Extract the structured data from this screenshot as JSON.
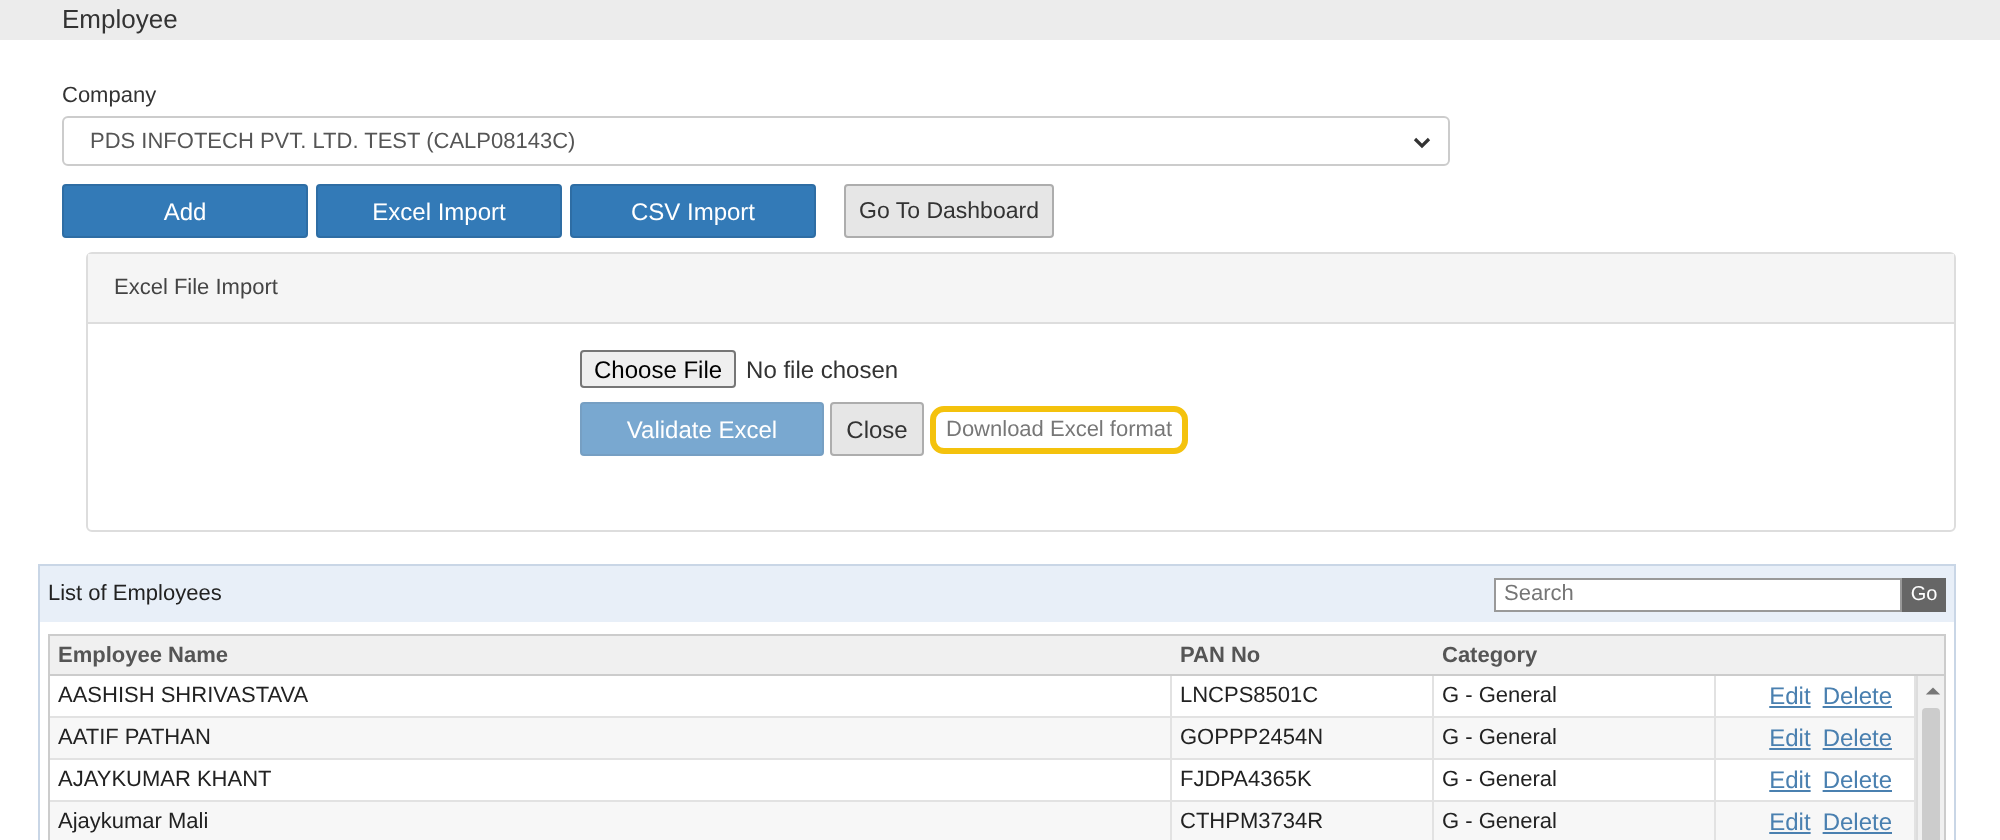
{
  "page_title": "Employee",
  "company": {
    "label": "Company",
    "value": "PDS INFOTECH PVT. LTD. TEST (CALP08143C)"
  },
  "actions": [
    {
      "label": "Add",
      "kind": "primary"
    },
    {
      "label": "Excel Import",
      "kind": "primary"
    },
    {
      "label": "CSV Import",
      "kind": "primary"
    },
    {
      "label": "Go To Dashboard",
      "kind": "secondary"
    }
  ],
  "import_panel": {
    "title": "Excel File Import",
    "file_button": "Choose File",
    "file_status": "No file chosen",
    "validate": {
      "label": "Validate Excel",
      "disabled": true
    },
    "close": "Close",
    "download_link": {
      "label": "Download Excel format",
      "highlighted": true
    }
  },
  "employee_list": {
    "title": "List of Employees",
    "search": {
      "placeholder": "Search"
    },
    "go": "Go",
    "columns": [
      "Employee Name",
      "PAN No",
      "Category"
    ],
    "rows": [
      {
        "name": "AASHISH SHRIVASTAVA",
        "pan": "LNCPS8501C",
        "category": "G - General",
        "edit": "Edit",
        "delete": "Delete"
      },
      {
        "name": "AATIF PATHAN",
        "pan": "GOPPP2454N",
        "category": "G - General",
        "edit": "Edit",
        "delete": "Delete"
      },
      {
        "name": "AJAYKUMAR KHANT",
        "pan": "FJDPA4365K",
        "category": "G - General",
        "edit": "Edit",
        "delete": "Delete"
      },
      {
        "name": "Ajaykumar Mali",
        "pan": "CTHPM3734R",
        "category": "G - General",
        "edit": "Edit",
        "delete": "Delete"
      }
    ]
  }
}
